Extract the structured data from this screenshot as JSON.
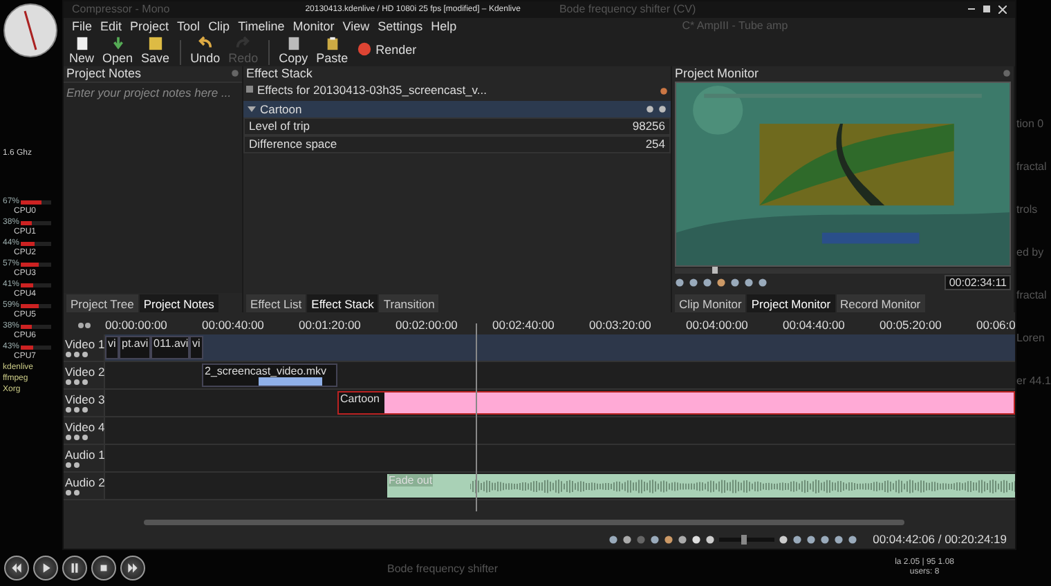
{
  "desktop": {
    "clock_speed": "1.6 Ghz",
    "cpus": [
      {
        "percent": "67%",
        "label": "CPU0",
        "level": 0.67
      },
      {
        "percent": "38%",
        "label": "CPU1",
        "level": 0.38
      },
      {
        "percent": "44%",
        "label": "CPU2",
        "level": 0.44
      },
      {
        "percent": "57%",
        "label": "CPU3",
        "level": 0.57
      },
      {
        "percent": "41%",
        "label": "CPU4",
        "level": 0.41
      },
      {
        "percent": "59%",
        "label": "CPU5",
        "level": 0.59
      },
      {
        "percent": "38%",
        "label": "CPU6",
        "level": 0.38
      },
      {
        "percent": "43%",
        "label": "CPU7",
        "level": 0.43
      }
    ],
    "processes": [
      "kdenlive",
      "ffmpeg",
      "Xorg"
    ],
    "right_texts": [
      "tion 0",
      "fractal",
      "trols",
      "ed by",
      "fractal",
      "Loren",
      "er 44.1"
    ],
    "bottom_text": "Bode frequency shifter",
    "system": [
      "la 2.05 | 95 1.08",
      "users: 8"
    ]
  },
  "window": {
    "title": "20130413.kdenlive / HD 1080i 25 fps [modified] – Kdenlive",
    "ghost_left": "Compressor - Mono",
    "ghost_right": "Bode frequency shifter (CV)",
    "ghost_menu": "C* AmpIII - Tube amp",
    "menu": [
      "File",
      "Edit",
      "Project",
      "Tool",
      "Clip",
      "Timeline",
      "Monitor",
      "View",
      "Settings",
      "Help"
    ],
    "toolbar": [
      {
        "label": "New",
        "disabled": false
      },
      {
        "label": "Open",
        "disabled": false
      },
      {
        "label": "Save",
        "disabled": false
      },
      {
        "label": "Undo",
        "disabled": false
      },
      {
        "label": "Redo",
        "disabled": true
      },
      {
        "label": "Copy",
        "disabled": false
      },
      {
        "label": "Paste",
        "disabled": false
      },
      {
        "label": "Render",
        "disabled": false
      }
    ]
  },
  "project_notes": {
    "title": "Project Notes",
    "placeholder": "Enter your project notes here ...",
    "tabs": [
      {
        "label": "Project Tree",
        "selected": false
      },
      {
        "label": "Project Notes",
        "selected": true
      }
    ]
  },
  "effect_stack": {
    "title": "Effect Stack",
    "header": "Effects for 20130413-03h35_screencast_v...",
    "effect": "Cartoon",
    "params": [
      {
        "label": "Level of trip",
        "value": "98256"
      },
      {
        "label": "Difference space",
        "value": "254"
      }
    ],
    "tabs": [
      {
        "label": "Effect List",
        "selected": false
      },
      {
        "label": "Effect Stack",
        "selected": true
      },
      {
        "label": "Transition",
        "selected": false
      }
    ]
  },
  "project_monitor": {
    "title": "Project Monitor",
    "timecode": "00:02:34:11",
    "seek": {
      "level": 0.11
    },
    "tabs": [
      {
        "label": "Clip Monitor",
        "selected": false
      },
      {
        "label": "Project Monitor",
        "selected": true
      },
      {
        "label": "Record Monitor",
        "selected": false
      }
    ]
  },
  "timeline": {
    "ruler": [
      "00:00:00:00",
      "00:00:40:00",
      "00:01:20:00",
      "00:02:00:00",
      "00:02:40:00",
      "00:03:20:00",
      "00:04:00:00",
      "00:04:40:00",
      "00:05:20:00",
      "00:06:0"
    ],
    "tracks": [
      {
        "name": "Video 1",
        "kind": "video",
        "clips": [
          {
            "label": "vi",
            "kind": "video"
          },
          {
            "label": "pt.avi",
            "kind": "video"
          },
          {
            "label": "011.avi",
            "kind": "video"
          },
          {
            "label": "vi",
            "kind": "video"
          }
        ]
      },
      {
        "name": "Video 2",
        "kind": "video",
        "clips": [
          {
            "label": "2_screencast_video.mkv",
            "kind": "video"
          }
        ]
      },
      {
        "name": "Video 3",
        "kind": "video",
        "clips": [
          {
            "label": "Cartoon",
            "kind": "color",
            "color": "#ffaad6"
          }
        ]
      },
      {
        "name": "Video 4",
        "kind": "video"
      },
      {
        "name": "Audio 1",
        "kind": "audio"
      },
      {
        "name": "Audio 2",
        "kind": "audio",
        "clips": [
          {
            "label": "Fade out",
            "kind": "audio",
            "color": "#a9d1b6"
          }
        ]
      }
    ],
    "zoom": {
      "level": 0.45
    },
    "position": "00:04:42:06 / 00:20:24:19"
  }
}
